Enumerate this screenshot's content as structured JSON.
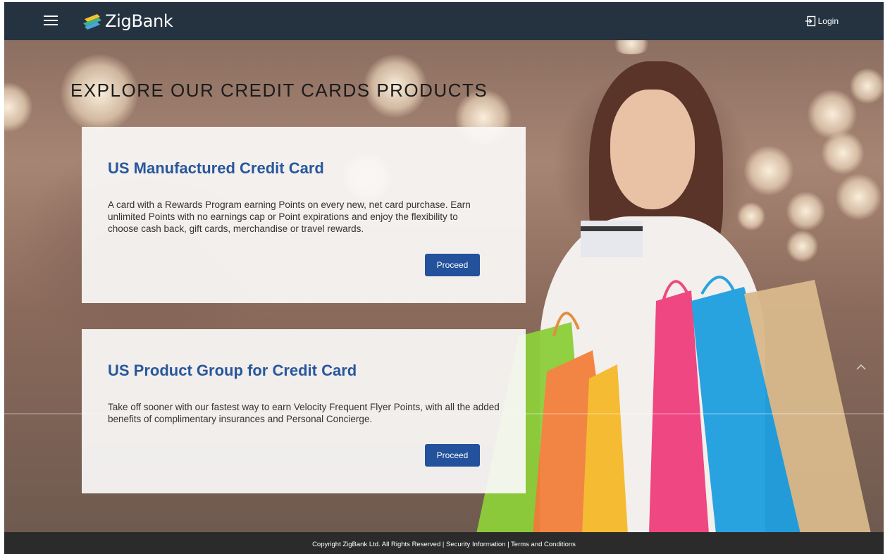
{
  "header": {
    "brand": "ZigBank",
    "login_label": "Login"
  },
  "icons": {
    "menu": "hamburger-menu-icon",
    "logo": "zigbank-logo-icon",
    "login": "login-arrow-icon",
    "scroll_up": "chevron-up-icon"
  },
  "colors": {
    "header_bg": "#253341",
    "accent_blue": "#23519b",
    "title_blue": "#28579c",
    "footer_bg": "#2b2b2b"
  },
  "main": {
    "page_title": "EXPLORE OUR CREDIT CARDS PRODUCTS",
    "products": [
      {
        "title": "US Manufactured Credit Card",
        "description": "A card with a Rewards Program earning Points on every new, net card purchase. Earn unlimited Points with no earnings cap or Point expirations and enjoy the flexibility to choose cash back, gift cards, merchandise or travel rewards.",
        "button_label": "Proceed"
      },
      {
        "title": "US Product Group for Credit Card",
        "description": "Take off sooner with our fastest way to earn Velocity Frequent Flyer Points, with all the added benefits of complimentary insurances and Personal Concierge.",
        "button_label": "Proceed"
      }
    ]
  },
  "footer": {
    "copyright": "Copyright ZigBank Ltd. All Rights Reserved",
    "separator": "|",
    "security_link": "Security Information",
    "terms_link": "Terms and Conditions"
  }
}
